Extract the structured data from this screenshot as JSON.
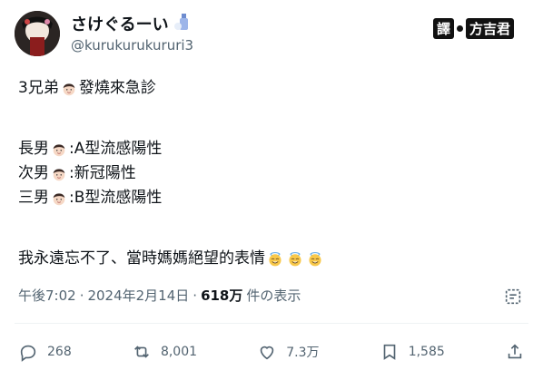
{
  "header": {
    "display_name": "さけぐるーい",
    "handle": "@kurukurukururi3",
    "translator_label_1": "譯",
    "translator_label_2": "方吉君"
  },
  "post": {
    "lines": [
      {
        "before": "3兄弟",
        "after": "發燒來急診"
      },
      {
        "before": "長男",
        "after": ":A型流感陽性"
      },
      {
        "before": "次男",
        "after": ":新冠陽性"
      },
      {
        "before": "三男",
        "after": ":B型流感陽性"
      }
    ],
    "final_line": "我永遠忘不了、當時媽媽絕望的表情"
  },
  "meta": {
    "time": "午後7:02",
    "sep": "·",
    "date": "2024年2月14日",
    "views": "618万",
    "views_label": "件の表示"
  },
  "actions": {
    "replies": "268",
    "reposts": "8,001",
    "likes": "7.3万",
    "bookmarks": "1,585"
  },
  "icons": [
    "avatar",
    "sake-bottle-icon",
    "boy-face-emoji",
    "halo-smile-emoji",
    "grok-icon",
    "reply-icon",
    "repost-icon",
    "like-icon",
    "bookmark-icon",
    "share-icon"
  ]
}
